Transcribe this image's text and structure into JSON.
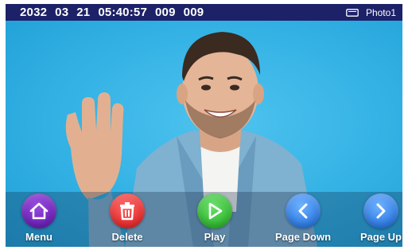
{
  "status_bar": {
    "date_year": "2032",
    "date_month": "03",
    "date_day": "21",
    "time": "05:40:57",
    "index": "009",
    "total": "009",
    "storage_icon": "sd-card-icon",
    "folder": "Photo1"
  },
  "photo": {
    "background_color": "#38b4e6"
  },
  "toolbar": {
    "buttons": [
      {
        "label": "Menu",
        "icon": "home-icon",
        "color": "#6a1fb5"
      },
      {
        "label": "Delete",
        "icon": "trash-icon",
        "color": "#e52a2a"
      },
      {
        "label": "Play",
        "icon": "play-icon",
        "color": "#2fb82f"
      },
      {
        "label": "Page Down",
        "icon": "chevron-left-icon",
        "color": "#2c79e2"
      },
      {
        "label": "Page Up",
        "icon": "chevron-right-icon",
        "color": "#2c79e2"
      }
    ]
  }
}
